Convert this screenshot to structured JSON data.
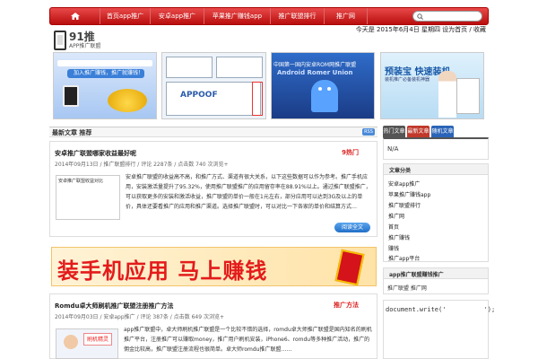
{
  "nav": {
    "items": [
      "首页app推广",
      "安卓app推广",
      "苹果推广赚钱app",
      "推广联盟排行",
      "推广网"
    ],
    "search_placeholder": ""
  },
  "logo": {
    "number": "91推",
    "tagline": "APP推广联盟"
  },
  "header": {
    "date_text": "今天是 2015年6月4日 星期四  设为首页 / 收藏"
  },
  "banners": {
    "b1_button": "加入推广赚钱，推广就赚钱！",
    "b2_label": "APPOOF",
    "b3_top": "中国第一国内安卓ROM网推广联盟",
    "b3_title": "Android Romer Union",
    "b4_title": "预装宝 快速装机",
    "b4_sub": "装机推广必备装机神器"
  },
  "section": {
    "title": "最新文章 推荐",
    "rss": "RSS"
  },
  "post1": {
    "title": "安卓推广联盟哪家收益最好呢",
    "tag": "9热门",
    "meta": "2014年09月13日 / 推广联盟排行 / 评论 2287条 / 点击数 740 次浏览+",
    "thumb_caption": "安卓推广联盟收益对比",
    "excerpt": "安卓推广联盟的收益高不高，和推广方式、渠道有很大关系，以下这些数据可以作为参考。推广手机应用，安装激活量提升了95.32%，使用推广联盟推广的应用留存率在88.91%以上。通过推广联盟推广，可以获取更多的安装和激活收益，推广联盟的单价一般在1元左右，部分应用可以达到3G及以上的单价，具体还要看推广的应用和推广渠道。选择推广联盟时，可以对比一下各家的单价和结算方式…",
    "more": "阅读全文"
  },
  "ad": {
    "text": "装手机应用 马上赚钱"
  },
  "post2": {
    "title": "Romdu卓大师刷机推广联盟注册推广方法",
    "tag": "推广方法",
    "meta": "2014年09月03日 / 安卓app推广 / 评论 387条 / 点击数 649 次浏览+",
    "thumb_tag": "刷机精灵",
    "excerpt": "app推广联盟中，卓大师刷机推广联盟是一个比较不错的选择，romdu卓大师推广联盟是国内知名的刷机推广平台，注册推广可以赚取money，推广用户刷机安装，iPhone6、romdu等多种推广活动，推广的佣金比较高，推广联盟注册流程也很简单。卓大师romdu推广联盟……"
  },
  "sidebar": {
    "tabs": [
      "热门文章",
      "最新文章",
      "随机文章"
    ],
    "na_text": "N/A",
    "cat_title": "文章分类",
    "categories": [
      "安卓app推广",
      "苹果推广赚钱app",
      "推广联盟排行",
      "推广网",
      "首页",
      "推广赚钱",
      "赚钱",
      "推广app平台"
    ],
    "app_title": "app推广联盟赚钱推广",
    "app_text": "推广联盟 推广网",
    "doc_text": "document.write('          ');"
  }
}
